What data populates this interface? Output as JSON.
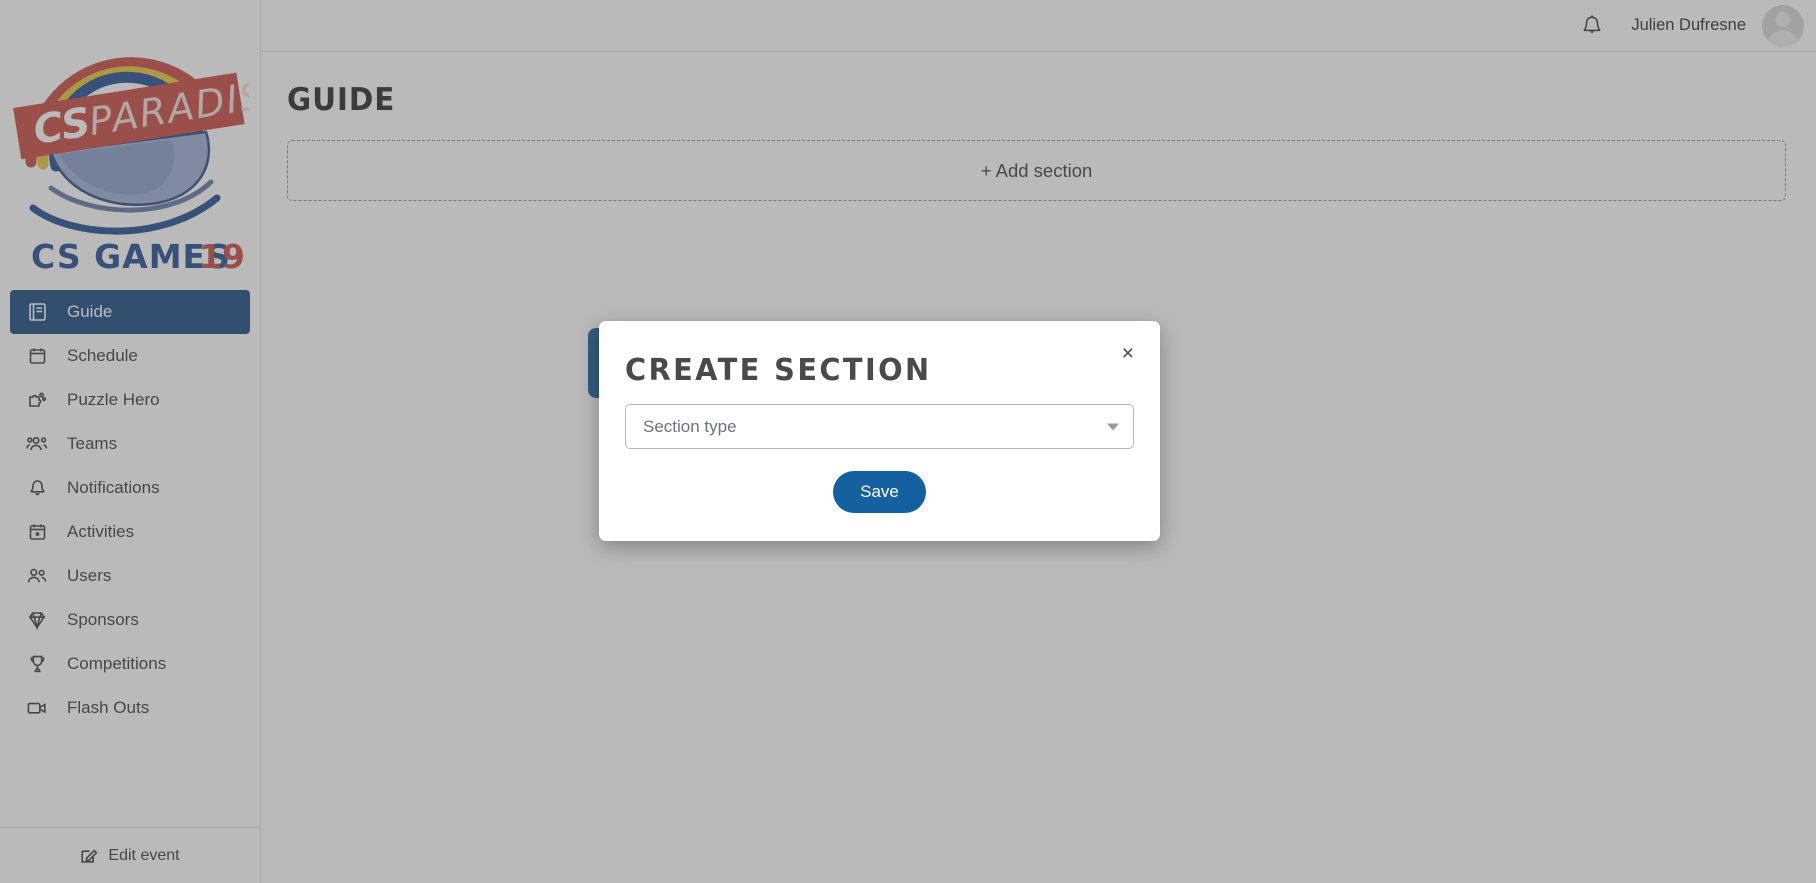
{
  "header": {
    "bell_icon": "bell-icon",
    "user_name": "Julien Dufresne",
    "avatar_icon": "user-avatar-placeholder"
  },
  "brand": {
    "banner_text": "CS PARADISE",
    "banner_cs": "CS",
    "banner_paradise": "PARADISE",
    "wordmark": "CS GAMES",
    "wordmark_year": "19",
    "colors": {
      "red": "#c8473f",
      "blue": "#1f4b8e",
      "yellow": "#e7c435",
      "ship_light": "#9badd4",
      "ship_dark": "#2c4a86"
    }
  },
  "sidebar": {
    "items": [
      {
        "label": "Guide",
        "icon": "book-icon",
        "active": true
      },
      {
        "label": "Schedule",
        "icon": "calendar-icon",
        "active": false
      },
      {
        "label": "Puzzle Hero",
        "icon": "puzzle-icon",
        "active": false
      },
      {
        "label": "Teams",
        "icon": "people-group-icon",
        "active": false
      },
      {
        "label": "Notifications",
        "icon": "bell-icon",
        "active": false
      },
      {
        "label": "Activities",
        "icon": "calendar-dot-icon",
        "active": false
      },
      {
        "label": "Users",
        "icon": "users-icon",
        "active": false
      },
      {
        "label": "Sponsors",
        "icon": "diamond-icon",
        "active": false
      },
      {
        "label": "Competitions",
        "icon": "trophy-icon",
        "active": false
      },
      {
        "label": "Flash Outs",
        "icon": "video-camera-icon",
        "active": false
      }
    ],
    "footer": {
      "label": "Edit event",
      "icon": "edit-pencil-icon"
    },
    "active_color": "#15487f"
  },
  "main": {
    "page_title": "GUIDE",
    "add_section_label": "+ Add section"
  },
  "modal": {
    "title": "CREATE  SECTION",
    "close_label": "×",
    "select": {
      "placeholder": "Section type",
      "value": "",
      "caret_icon": "chevron-down-icon"
    },
    "save_label": "Save",
    "save_color": "#15609e"
  }
}
